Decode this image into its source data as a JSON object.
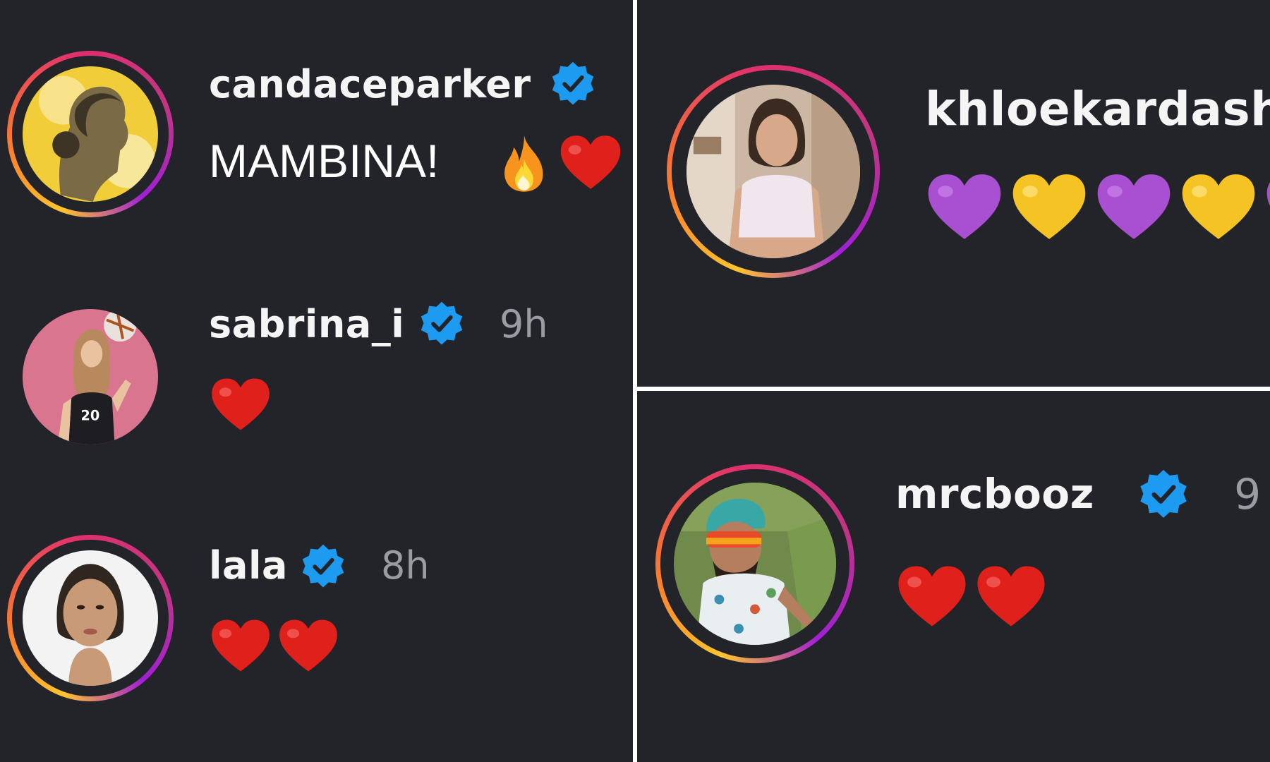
{
  "panels": {
    "left": {
      "comments": [
        {
          "username": "candaceparker",
          "verified": true,
          "time": "",
          "text": "MAMBINA!",
          "reactions": [
            "fire-icon",
            "red-heart-icon"
          ]
        },
        {
          "username": "sabrina_i",
          "verified": true,
          "time": "9h",
          "text": "",
          "reactions": [
            "red-heart-icon"
          ]
        },
        {
          "username": "lala",
          "verified": true,
          "time": "8h",
          "text": "",
          "reactions": [
            "red-heart-icon",
            "red-heart-icon"
          ]
        }
      ]
    },
    "top_right": {
      "comments": [
        {
          "username": "khloekardash",
          "verified": false,
          "time": "",
          "text": "",
          "reactions": [
            "purple-heart-icon",
            "yellow-heart-icon",
            "purple-heart-icon",
            "yellow-heart-icon",
            "purple-heart-icon"
          ]
        }
      ]
    },
    "bottom_right": {
      "comments": [
        {
          "username": "mrcbooz",
          "verified": true,
          "time": "9",
          "text": "",
          "reactions": [
            "red-heart-icon",
            "red-heart-icon"
          ]
        }
      ]
    }
  },
  "colors": {
    "background": "#23242a",
    "username": "#f5f5f5",
    "timestamp": "#9a9ca3",
    "verified_badge": "#1d9bf0",
    "heart_red": "#e0201b",
    "heart_purple": "#a94fd1",
    "heart_yellow": "#f6c324",
    "divider": "#ffffff"
  }
}
